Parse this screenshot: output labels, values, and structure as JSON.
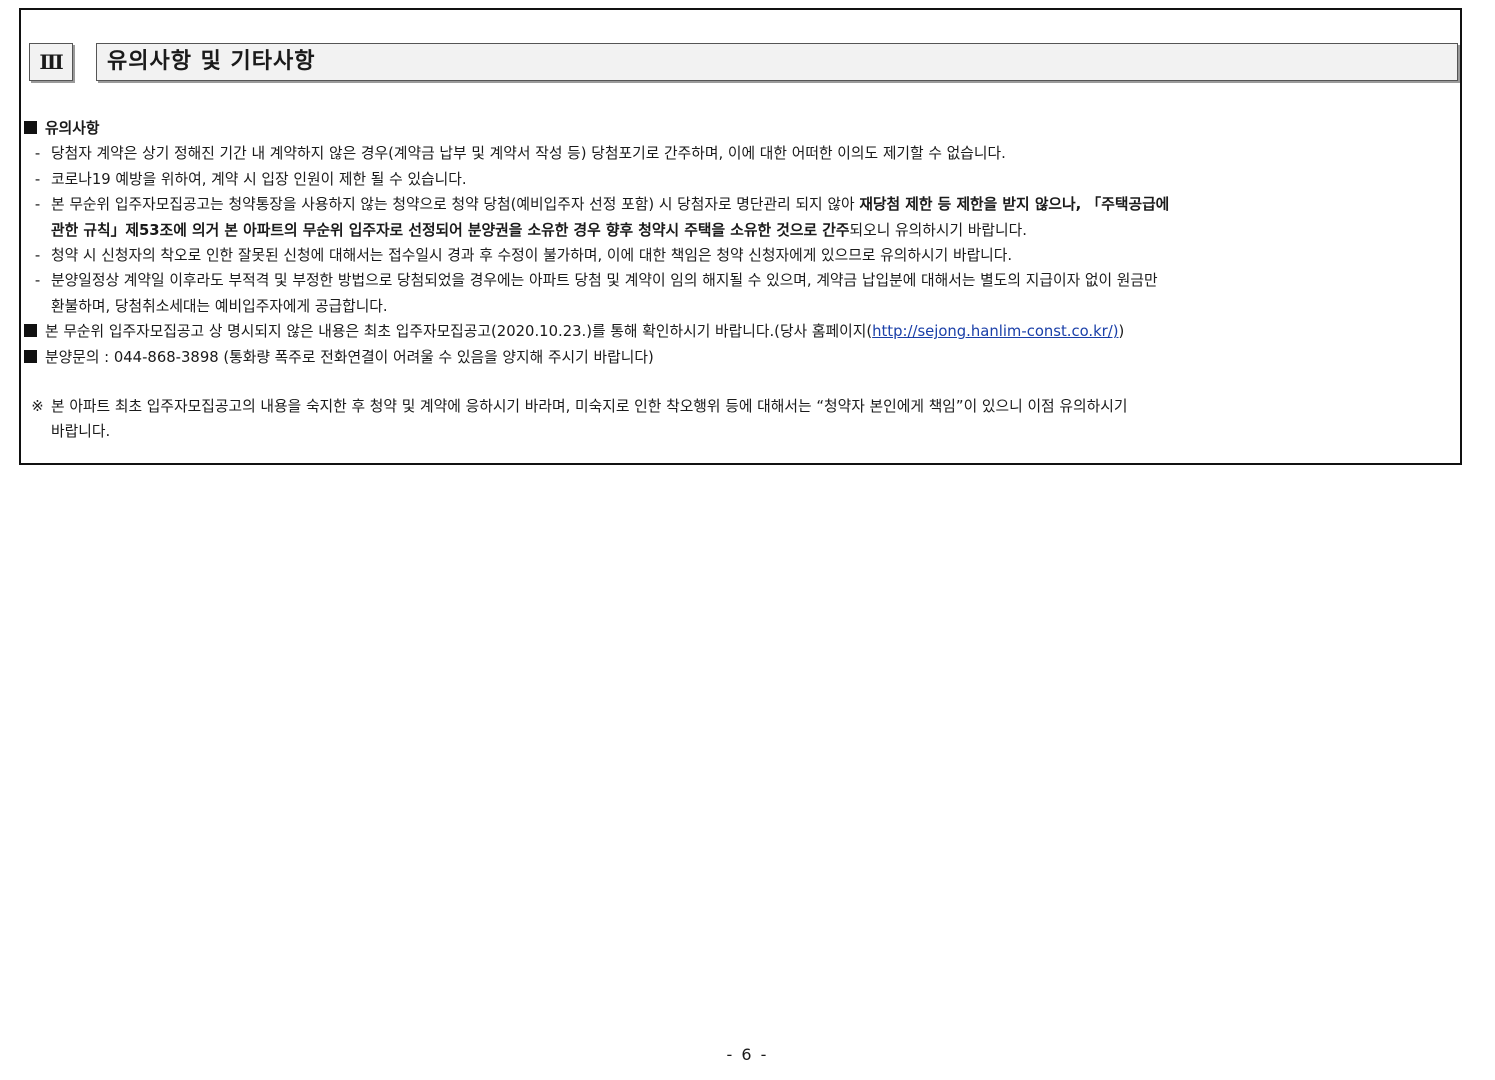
{
  "section": {
    "number": "Ⅲ",
    "title": "유의사항 및 기타사항"
  },
  "notice_heading": "유의사항",
  "items": {
    "item1": "당첨자 계약은 상기 정해진 기간 내 계약하지 않은 경우(계약금 납부 및 계약서 작성 등) 당첨포기로 간주하며, 이에 대한 어떠한 이의도 제기할 수 없습니다.",
    "item2": "코로나19 예방을 위하여, 계약 시 입장 인원이 제한 될 수 있습니다.",
    "item3_line1_normal": "본 무순위 입주자모집공고는 청약통장을 사용하지 않는 청약으로 청약 당첨(예비입주자 선정 포함) 시 당첨자로 명단관리 되지 않아 ",
    "item3_line1_bold": "재당첨 제한 등 제한을 받지 않으나, 「주택공급에",
    "item3_line2_bold": "관한 규칙」제53조에 의거 본 아파트의 무순위 입주자로 선정되어 분양권을 소유한 경우 향후 청약시 주택을 소유한 것으로 간주",
    "item3_line2_normal": "되오니 유의하시기 바랍니다.",
    "item4": "청약 시 신청자의 착오로 인한 잘못된 신청에 대해서는 접수일시 경과 후 수정이 불가하며, 이에 대한 책임은 청약 신청자에게 있으므로 유의하시기 바랍니다.",
    "item5_line1": "분양일정상 계약일 이후라도 부적격 및 부정한 방법으로 당첨되었을 경우에는 아파트 당첨 및 계약이 임의 해지될 수 있으며, 계약금 납입분에 대해서는 별도의 지급이자 없이 원금만",
    "item5_line2": "환불하며, 당첨취소세대는 예비입주자에게 공급합니다."
  },
  "dash": "-",
  "info1": {
    "text": "본 무순위 입주자모집공고 상 명시되지 않은 내용은 최초 입주자모집공고(2020.10.23.)를 통해 확인하시기 바랍니다.(당사 홈페이지(",
    "link": "http://sejong.hanlim-const.co.kr/)",
    "close": ")"
  },
  "info2": {
    "text": "분양문의 : 044-868-3898 (통화량 폭주로 전화연결이 어려울 수 있음을 양지해 주시기 바랍니다)"
  },
  "note": {
    "mark": "※",
    "line1": "본 아파트 최초 입주자모집공고의 내용을 숙지한 후 청약 및 계약에 응하시기 바라며, 미숙지로 인한 착오행위 등에 대해서는 “청약자 본인에게 책임”이 있으니 이점 유의하시기",
    "line2": "바랍니다."
  },
  "page_number": "- 6 -"
}
